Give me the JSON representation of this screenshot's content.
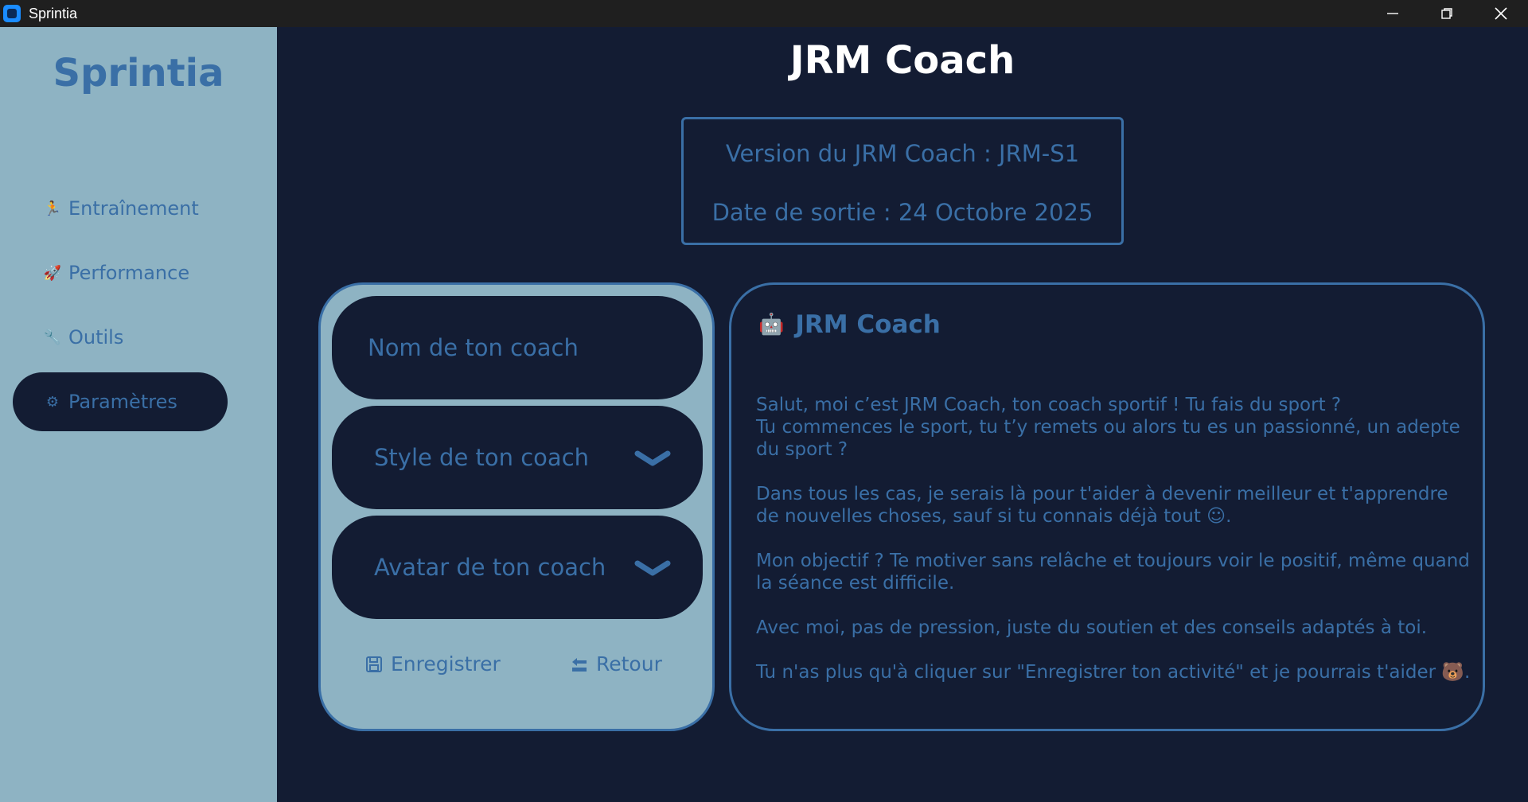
{
  "window": {
    "title": "Sprintia",
    "controls": [
      "minimize-icon",
      "restore-icon",
      "close-icon"
    ]
  },
  "sidebar": {
    "brand": "Sprintia",
    "items": [
      {
        "label": "Entraînement",
        "icon": "runner-icon"
      },
      {
        "label": "Performance",
        "icon": "rocket-icon"
      },
      {
        "label": "Outils",
        "icon": "wrench-icon"
      },
      {
        "label": "Paramètres",
        "icon": "gear-icon",
        "active": true
      }
    ]
  },
  "main": {
    "title": "JRM Coach",
    "version_line": "Version du JRM Coach : JRM-S1",
    "date_line": "Date de sortie : 24 Octobre 2025"
  },
  "form": {
    "name_placeholder": "Nom de ton coach",
    "style_label": "Style de ton coach",
    "avatar_label": "Avatar de ton coach",
    "save_label": "Enregistrer",
    "back_label": "Retour"
  },
  "info": {
    "title": "JRM Coach",
    "title_icon": "robot-face-icon",
    "paragraphs": [
      "Salut, moi c’est JRM Coach, ton coach sportif ! Tu fais du sport ?\nTu commences le sport, tu t’y remets ou alors tu es un passionné, un adepte du sport ?",
      "Dans tous les cas, je serais là pour t'aider à devenir meilleur et t'apprendre de nouvelles choses, sauf si tu connais déjà tout ☺.",
      "Mon objectif ? Te motiver sans relâche et toujours voir le positif, même quand la séance est difficile.",
      "Avec moi, pas de pression, juste du soutien et des conseils adaptés à toi.",
      "Tu n'as plus qu'à cliquer sur \"Enregistrer ton activité\" et je pourrais t'aider 🐻."
    ]
  },
  "colors": {
    "background": "#131c33",
    "sidebar": "#8eb3c3",
    "accent": "#3a6fa6",
    "title": "#ffffff"
  }
}
